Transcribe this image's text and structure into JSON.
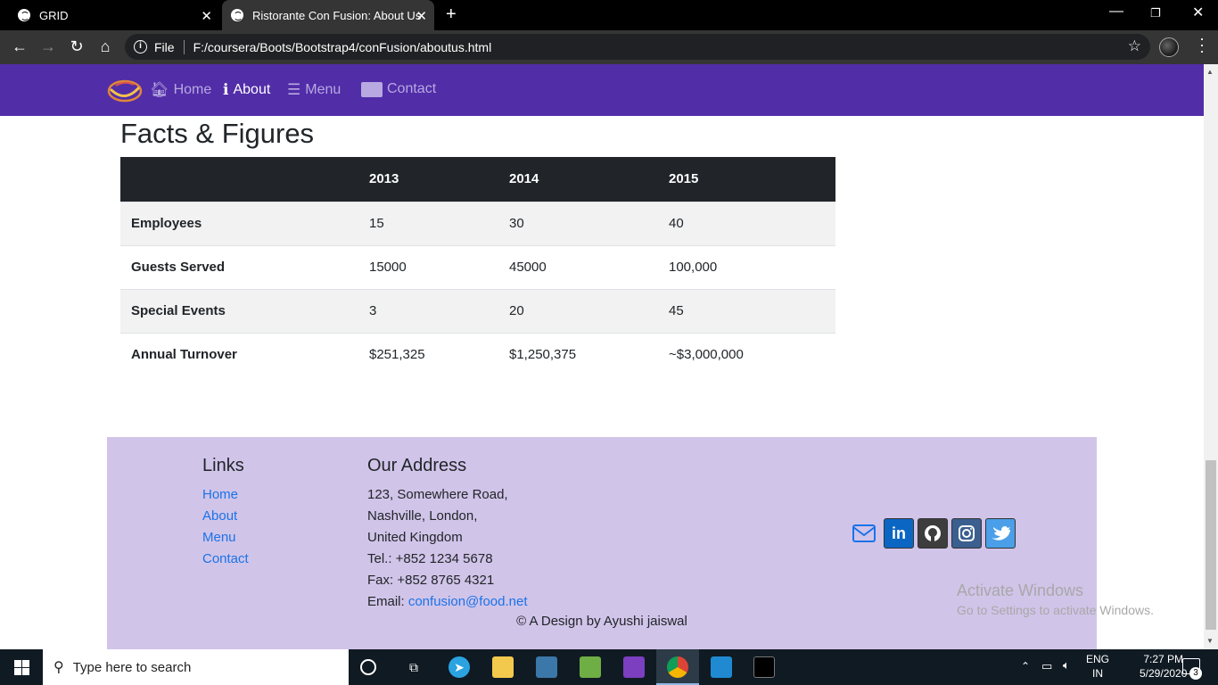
{
  "browser": {
    "tabs": [
      {
        "label": "GRID"
      },
      {
        "label": "Ristorante Con Fusion: About Us"
      }
    ],
    "url_scheme": "File",
    "url": "F:/coursera/Boots/Bootstrap4/conFusion/aboutus.html"
  },
  "nav": {
    "items": [
      {
        "label": "Home",
        "icon": "home-icon"
      },
      {
        "label": "About",
        "icon": "info-icon",
        "active": true
      },
      {
        "label": "Menu",
        "icon": "list-icon"
      },
      {
        "label": "Contact",
        "icon": "address-card-icon"
      }
    ]
  },
  "page": {
    "heading": "Facts & Figures",
    "table": {
      "columns": [
        "",
        "2013",
        "2014",
        "2015"
      ],
      "rows": [
        {
          "label": "Employees",
          "values": [
            "15",
            "30",
            "40"
          ]
        },
        {
          "label": "Guests Served",
          "values": [
            "15000",
            "45000",
            "100,000"
          ]
        },
        {
          "label": "Special Events",
          "values": [
            "3",
            "20",
            "45"
          ]
        },
        {
          "label": "Annual Turnover",
          "values": [
            "$251,325",
            "$1,250,375",
            "~$3,000,000"
          ]
        }
      ]
    }
  },
  "footer": {
    "links_heading": "Links",
    "links": [
      "Home",
      "About",
      "Menu",
      "Contact"
    ],
    "address_heading": "Our Address",
    "address_lines": [
      "123, Somewhere Road,",
      "Nashville, London,",
      "United Kingdom",
      "Tel.: +852 1234 5678",
      "Fax: +852 8765 4321"
    ],
    "email_label": "Email: ",
    "email": "confusion@food.net",
    "copyright": "© A Design by Ayushi jaiswal",
    "social": [
      "envelope-icon",
      "linkedin-icon",
      "github-icon",
      "instagram-icon",
      "twitter-icon"
    ]
  },
  "windows": {
    "activate_title": "Activate Windows",
    "activate_sub": "Go to Settings to activate Windows.",
    "search_placeholder": "Type here to search",
    "lang_line1": "ENG",
    "lang_line2": "IN",
    "time": "7:27 PM",
    "date": "5/29/2020",
    "notifications": "3"
  },
  "colors": {
    "navbar": "#512da8",
    "footer": "#d1c4e9",
    "table_header": "#212529",
    "link": "#1a73e8"
  }
}
